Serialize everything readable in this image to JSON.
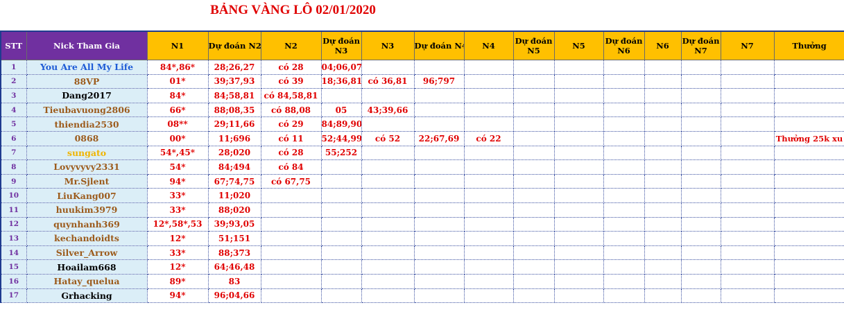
{
  "title": "BẢNG VÀNG LÔ 02/01/2020",
  "columns": [
    "STT",
    "Nick Tham Gia",
    "N1",
    "Dự đoán N2",
    "N2",
    "Dự đoán N3",
    "N3",
    "Dự đoán N4",
    "N4",
    "Dự đoán N5",
    "N5",
    "Dự đoán N6",
    "N6",
    "Dự đoán N7",
    "N7",
    "Thưởng"
  ],
  "colors": {
    "header_yellow": "#ffc000",
    "header_purple": "#7030a0",
    "value_red": "#e00000",
    "nick_bg": "#dbeef7",
    "grid_blue": "#3a4fa0"
  },
  "rows": [
    {
      "stt": "1",
      "nick": "You Are All My Life",
      "nick_color": "#1f5cd6",
      "cells": [
        "84*,86*",
        "28;26,27",
        "có 28",
        "04;06,07",
        "",
        "",
        "",
        "",
        "",
        "",
        "",
        "",
        "",
        ""
      ]
    },
    {
      "stt": "2",
      "nick": "88VP",
      "nick_color": "#9c5b1c",
      "cells": [
        "01*",
        "39;37,93",
        "có 39",
        "18;36,81",
        "có 36,81",
        "96;797",
        "",
        "",
        "",
        "",
        "",
        "",
        "",
        ""
      ]
    },
    {
      "stt": "3",
      "nick": "Dang2017",
      "nick_color": "#000000",
      "cells": [
        "84*",
        "84;58,81",
        "có 84,58,81",
        "",
        "",
        "",
        "",
        "",
        "",
        "",
        "",
        "",
        "",
        ""
      ]
    },
    {
      "stt": "4",
      "nick": "Tieubavuong2806",
      "nick_color": "#9c5b1c",
      "cells": [
        "66*",
        "88;08,35",
        "có 88,08",
        "05",
        "43;39,66",
        "",
        "",
        "",
        "",
        "",
        "",
        "",
        "",
        ""
      ]
    },
    {
      "stt": "5",
      "nick": "thiendia2530",
      "nick_color": "#9c5b1c",
      "cells": [
        "08**",
        "29;11,66",
        "có 29",
        "84;89,90",
        "",
        "",
        "",
        "",
        "",
        "",
        "",
        "",
        "",
        ""
      ]
    },
    {
      "stt": "6",
      "nick": "0868",
      "nick_color": "#9c5b1c",
      "cells": [
        "00*",
        "11;696",
        "có 11",
        "52;44,99",
        "có 52",
        "22;67,69",
        "có 22",
        "",
        "",
        "",
        "",
        "",
        "",
        "Thưởng 25k xu"
      ]
    },
    {
      "stt": "7",
      "nick": "sungato",
      "nick_color": "#f0b400",
      "cells": [
        "54*,45*",
        "28;020",
        "có 28",
        "55;252",
        "",
        "",
        "",
        "",
        "",
        "",
        "",
        "",
        "",
        ""
      ]
    },
    {
      "stt": "8",
      "nick": "Lovyvyvy2331",
      "nick_color": "#9c5b1c",
      "cells": [
        "54*",
        "84;494",
        "có 84",
        "",
        "",
        "",
        "",
        "",
        "",
        "",
        "",
        "",
        "",
        ""
      ]
    },
    {
      "stt": "9",
      "nick": "Mr.Sjlent",
      "nick_color": "#9c5b1c",
      "cells": [
        "94*",
        "67;74,75",
        "có 67,75",
        "",
        "",
        "",
        "",
        "",
        "",
        "",
        "",
        "",
        "",
        ""
      ]
    },
    {
      "stt": "10",
      "nick": "LiuKang007",
      "nick_color": "#9c5b1c",
      "cells": [
        "33*",
        "11;020",
        "",
        "",
        "",
        "",
        "",
        "",
        "",
        "",
        "",
        "",
        "",
        ""
      ]
    },
    {
      "stt": "11",
      "nick": "huukim3979",
      "nick_color": "#9c5b1c",
      "cells": [
        "33*",
        "88;020",
        "",
        "",
        "",
        "",
        "",
        "",
        "",
        "",
        "",
        "",
        "",
        ""
      ]
    },
    {
      "stt": "12",
      "nick": "quynhanh369",
      "nick_color": "#9c5b1c",
      "cells": [
        "12*,58*,53",
        "39;93,05",
        "",
        "",
        "",
        "",
        "",
        "",
        "",
        "",
        "",
        "",
        "",
        ""
      ]
    },
    {
      "stt": "13",
      "nick": "kechandoidts",
      "nick_color": "#9c5b1c",
      "cells": [
        "12*",
        "51;151",
        "",
        "",
        "",
        "",
        "",
        "",
        "",
        "",
        "",
        "",
        "",
        ""
      ]
    },
    {
      "stt": "14",
      "nick": "Silver_Arrow",
      "nick_color": "#9c5b1c",
      "cells": [
        "33*",
        "88;373",
        "",
        "",
        "",
        "",
        "",
        "",
        "",
        "",
        "",
        "",
        "",
        ""
      ]
    },
    {
      "stt": "15",
      "nick": "Hoailam668",
      "nick_color": "#000000",
      "cells": [
        "12*",
        "64;46,48",
        "",
        "",
        "",
        "",
        "",
        "",
        "",
        "",
        "",
        "",
        "",
        ""
      ]
    },
    {
      "stt": "16",
      "nick": "Hatay_quelua",
      "nick_color": "#9c5b1c",
      "cells": [
        "89*",
        "83",
        "",
        "",
        "",
        "",
        "",
        "",
        "",
        "",
        "",
        "",
        "",
        ""
      ]
    },
    {
      "stt": "17",
      "nick": "Grhacking",
      "nick_color": "#000000",
      "cells": [
        "94*",
        "96;04,66",
        "",
        "",
        "",
        "",
        "",
        "",
        "",
        "",
        "",
        "",
        "",
        ""
      ]
    }
  ]
}
